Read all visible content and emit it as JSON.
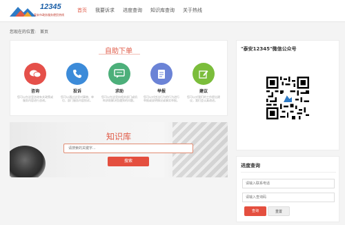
{
  "header": {
    "logo_number": "12345",
    "logo_subtitle": "泰安市政务服务便民热线",
    "nav": [
      {
        "label": "首页",
        "active": true
      },
      {
        "label": "我要诉求",
        "active": false
      },
      {
        "label": "进度查询",
        "active": false
      },
      {
        "label": "知识库查询",
        "active": false
      },
      {
        "label": "关于热线",
        "active": false
      }
    ]
  },
  "breadcrumb": {
    "prefix": "您现在的位置:",
    "current": "首页"
  },
  "self_service": {
    "title": "自助下单",
    "cards": [
      {
        "title": "咨询",
        "desc": "您可以在这里咨询有关政策或服务内容进行咨询。",
        "color": "#e5504a",
        "icon": "chat-icon"
      },
      {
        "title": "投诉",
        "desc": "您可以通过这里对事物、单位、部门服务内容投诉。",
        "color": "#3c8bd9",
        "icon": "phone-icon"
      },
      {
        "title": "求助",
        "desc": "您可以在这里向相关部门或机构求助解决您遇到的问题。",
        "color": "#4caf7a",
        "icon": "help-icon"
      },
      {
        "title": "举报",
        "desc": "您可以对违法行为的行为进行举报或说明情况或事实举报。",
        "color": "#6b83d6",
        "icon": "report-icon"
      },
      {
        "title": "建议",
        "desc": "您可以对我们的工作提出建议，我们会认真改进。",
        "color": "#7bbd3b",
        "icon": "pencil-icon"
      }
    ]
  },
  "knowledge_base": {
    "title": "知识库",
    "search_placeholder": "请搜索的关键字...",
    "button_label": "搜索"
  },
  "wechat": {
    "title": "\"泰安12345\"微信公众号"
  },
  "progress": {
    "title": "进度查询",
    "phone_placeholder": "请输入联系电话",
    "code_placeholder": "请输入查询码",
    "query_label": "查询",
    "reset_label": "重置"
  },
  "colors": {
    "accent": "#e44f3f",
    "nav_active": "#e05a47",
    "logo_blue": "#1a5fa8"
  }
}
